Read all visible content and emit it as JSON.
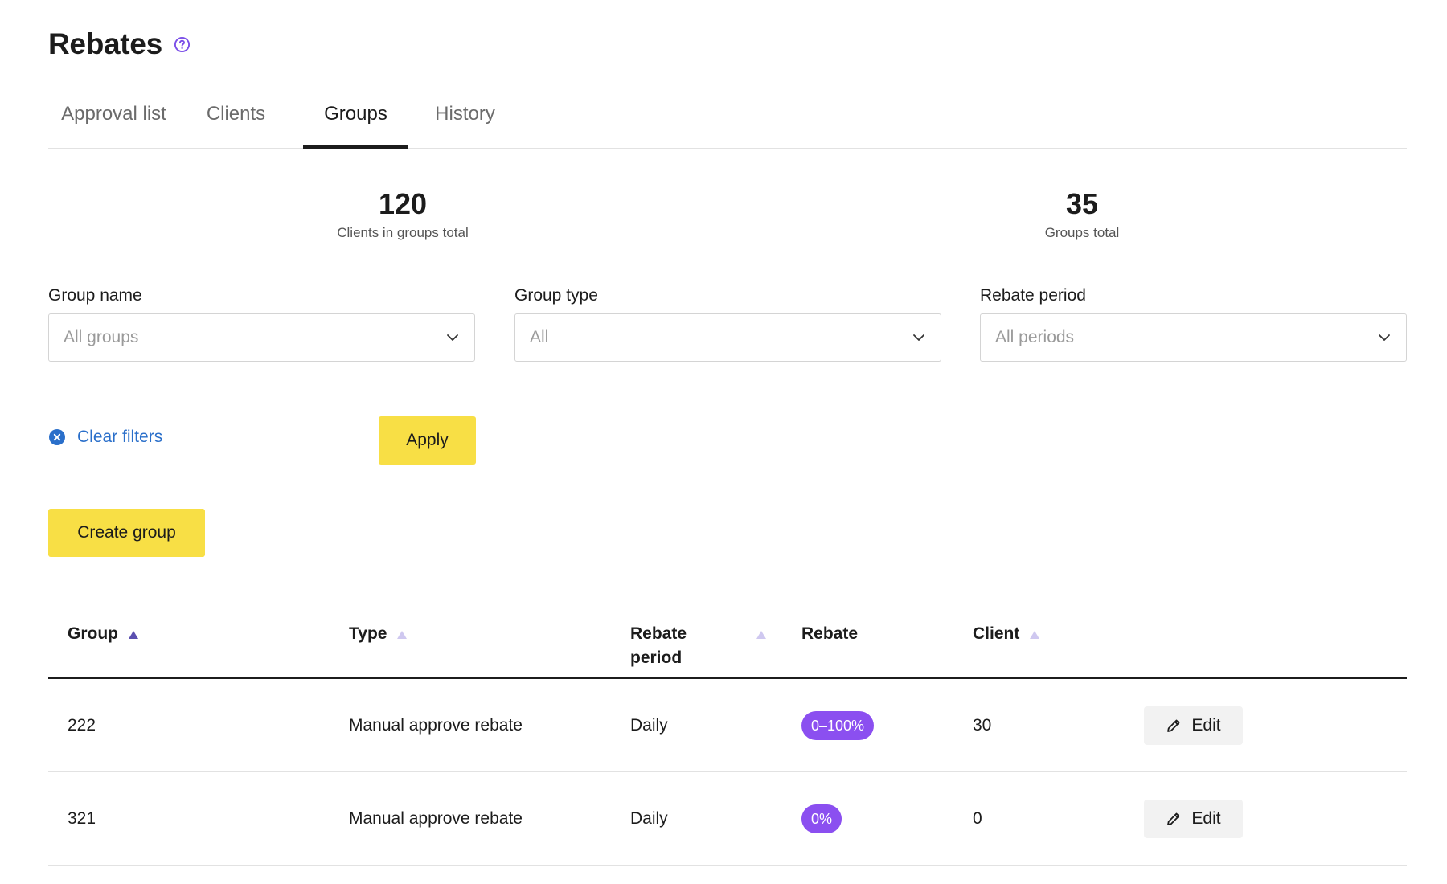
{
  "page": {
    "title": "Rebates",
    "help_icon": "help-circle-icon"
  },
  "tabs": [
    {
      "label": "Approval list",
      "active": false
    },
    {
      "label": "Clients",
      "active": false
    },
    {
      "label": "Groups",
      "active": true
    },
    {
      "label": "History",
      "active": false
    }
  ],
  "stats": {
    "clients_total": {
      "value": "120",
      "label": "Clients in groups total"
    },
    "groups_total": {
      "value": "35",
      "label": "Groups total"
    }
  },
  "filters": {
    "group_name": {
      "label": "Group name",
      "value": "All groups"
    },
    "group_type": {
      "label": "Group type",
      "value": "All"
    },
    "rebate_period": {
      "label": "Rebate period",
      "value": "All periods"
    }
  },
  "actions": {
    "clear_filters": "Clear filters",
    "apply": "Apply",
    "create_group": "Create group"
  },
  "table": {
    "columns": {
      "group": "Group",
      "type": "Type",
      "rebate_period_line1": "Rebate",
      "rebate_period_line2": "period",
      "rebate": "Rebate",
      "client": "Client"
    },
    "rows": [
      {
        "group": "222",
        "type": "Manual approve rebate",
        "period": "Daily",
        "rebate": "0–100%",
        "client": "30",
        "edit": "Edit"
      },
      {
        "group": "321",
        "type": "Manual approve rebate",
        "period": "Daily",
        "rebate": "0%",
        "client": "0",
        "edit": "Edit"
      }
    ]
  },
  "colors": {
    "accent_yellow": "#f8df45",
    "badge_purple": "#8b4ff0",
    "link_blue": "#2a6fca",
    "sort_active": "#5b4fb0",
    "sort_inactive": "#cfc8f0"
  }
}
